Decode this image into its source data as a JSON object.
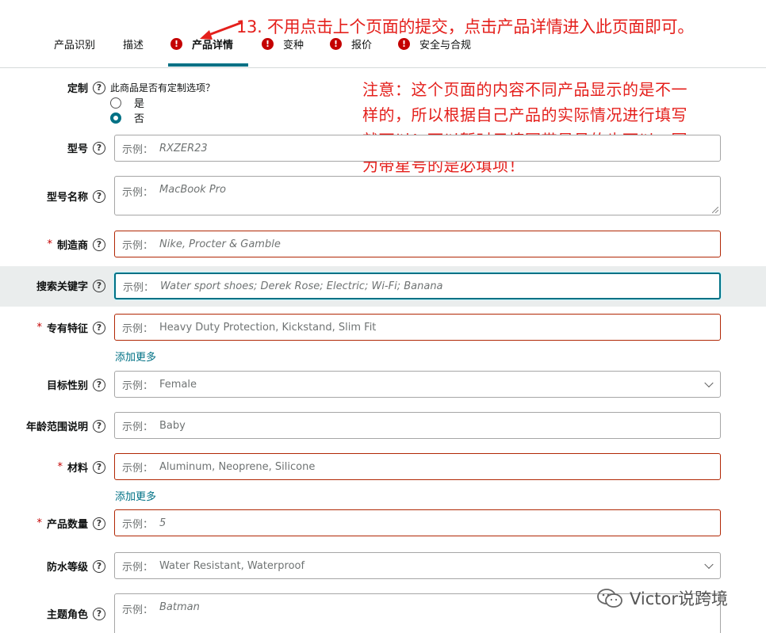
{
  "tabs": [
    {
      "label": "产品识别",
      "error": false,
      "active": false
    },
    {
      "label": "描述",
      "error": false,
      "active": false
    },
    {
      "label": "产品详情",
      "error": true,
      "active": true
    },
    {
      "label": "变种",
      "error": true,
      "active": false
    },
    {
      "label": "报价",
      "error": true,
      "active": false
    },
    {
      "label": "安全与合规",
      "error": true,
      "active": false
    }
  ],
  "annotations": {
    "top": "13. 不用点击上个页面的提交，点击产品详情进入此页面即可。",
    "note_lines": [
      "注意：这个页面的内容不同产品显示的是不一",
      "样的，所以根据自己产品的实际情况进行填写",
      "就可以！可以暂时只填写带星号的也可以，因",
      "为带星号的是必填项！"
    ]
  },
  "customization": {
    "label": "定制",
    "question": "此商品是否有定制选项？",
    "options": [
      {
        "label": "是",
        "checked": false
      },
      {
        "label": "否",
        "checked": true
      }
    ]
  },
  "fields": {
    "model_number": {
      "label": "型号",
      "placeholder": "RXZER23"
    },
    "model_name": {
      "label": "型号名称",
      "placeholder": "MacBook Pro"
    },
    "manufacturer": {
      "label": "制造商",
      "placeholder": "Nike, Procter & Gamble"
    },
    "search_terms": {
      "label": "搜索关键字",
      "placeholder": "Water sport shoes; Derek Rose; Electric; Wi-Fi; Banana"
    },
    "special_feature": {
      "label": "专有特征",
      "placeholder": "Heavy Duty Protection, Kickstand, Slim Fit"
    },
    "target_gender": {
      "label": "目标性别",
      "placeholder": "Female"
    },
    "age_range": {
      "label": "年龄范围说明",
      "placeholder": "Baby"
    },
    "material": {
      "label": "材料",
      "placeholder": "Aluminum, Neoprene, Silicone"
    },
    "quantity": {
      "label": "产品数量",
      "placeholder": "5"
    },
    "water_resistance": {
      "label": "防水等级",
      "placeholder": "Water Resistant, Waterproof"
    },
    "subject_character": {
      "label": "主题角色",
      "placeholder": "Batman"
    }
  },
  "placeholder_prefix": "示例：",
  "required_mark": "*",
  "help_glyph": "?",
  "error_glyph": "!",
  "add_more": "添加更多",
  "watermark": "Victor说跨境",
  "colors": {
    "accent": "#007185",
    "error": "#c40000",
    "required_border": "#b12704",
    "annotation": "#e4201c"
  }
}
